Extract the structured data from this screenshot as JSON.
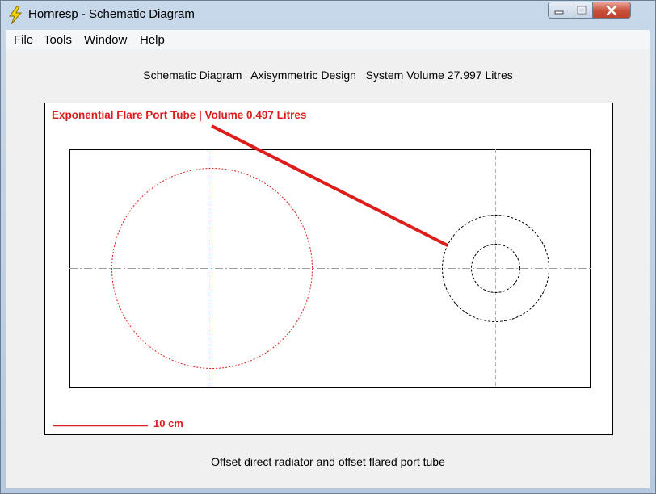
{
  "window": {
    "title": "Hornresp - Schematic Diagram"
  },
  "menu": [
    "File",
    "Tools",
    "Window",
    "Help"
  ],
  "heading": "Schematic Diagram   Axisymmetric Design   System Volume 27.997 Litres",
  "diagram": {
    "callout": "Exponential Flare Port Tube | Volume 0.497 Litres",
    "scale_label": "10 cm"
  },
  "footer": "Offset direct radiator and offset flared port tube",
  "colors": {
    "accent_red": "#dd1c1c",
    "close_button": "#c7462f",
    "guide_gray": "#a0a0a0"
  },
  "icons": {
    "app": "lightning-bolt-icon",
    "minimize": "minimize-icon",
    "maximize": "maximize-icon",
    "close": "close-icon"
  }
}
